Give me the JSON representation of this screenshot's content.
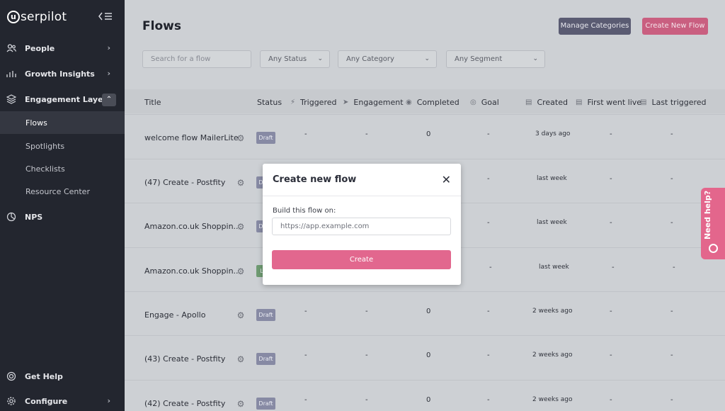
{
  "brand": {
    "logo_letter": "u",
    "logo_rest": "serpilot"
  },
  "sidebar": {
    "items": [
      {
        "label": "People"
      },
      {
        "label": "Growth Insights"
      },
      {
        "label": "Engagement Layer"
      },
      {
        "label": "NPS"
      },
      {
        "label": "Get Help"
      },
      {
        "label": "Configure"
      }
    ],
    "sub_items": [
      {
        "label": "Flows"
      },
      {
        "label": "Spotlights"
      },
      {
        "label": "Checklists"
      },
      {
        "label": "Resource Center"
      }
    ]
  },
  "header": {
    "title": "Flows",
    "manage_label": "Manage Categories",
    "create_label": "Create New Flow"
  },
  "filters": {
    "search_placeholder": "Search for a flow",
    "status": "Any Status",
    "category": "Any Category",
    "segment": "Any Segment"
  },
  "table": {
    "columns": [
      "Title",
      "Status",
      "Triggered",
      "Engagement",
      "Completed",
      "Goal",
      "Created",
      "First went live",
      "Last triggered"
    ],
    "rows": [
      {
        "title": "welcome flow MailerLite",
        "status": "Draft",
        "triggered": "-",
        "engagement": "-",
        "completed": "0",
        "goal": "-",
        "created": "3 days ago",
        "first_live": "-",
        "last_triggered": "-"
      },
      {
        "title": "(47) Create - Postfity",
        "status": "Draft",
        "triggered": "",
        "engagement": "",
        "completed": "",
        "goal": "-",
        "created": "last week",
        "first_live": "-",
        "last_triggered": "-"
      },
      {
        "title": "Amazon.co.uk Shoppin...",
        "status": "Draft",
        "triggered": "",
        "engagement": "",
        "completed": "",
        "goal": "-",
        "created": "last week",
        "first_live": "-",
        "last_triggered": "-"
      },
      {
        "title": "Amazon.co.uk Shoppin...",
        "status": "Live",
        "triggered": "",
        "engagement": "",
        "completed": "",
        "goal": "-",
        "created": "last week",
        "first_live": "-",
        "last_triggered": "-"
      },
      {
        "title": "Engage - Apollo",
        "status": "Draft",
        "triggered": "-",
        "engagement": "-",
        "completed": "0",
        "goal": "-",
        "created": "2 weeks ago",
        "first_live": "-",
        "last_triggered": "-"
      },
      {
        "title": "(43) Create - Postfity",
        "status": "Draft",
        "triggered": "-",
        "engagement": "-",
        "completed": "0",
        "goal": "-",
        "created": "2 weeks ago",
        "first_live": "-",
        "last_triggered": "-"
      },
      {
        "title": "(42) Create - Postfity",
        "status": "Draft",
        "triggered": "-",
        "engagement": "-",
        "completed": "0",
        "goal": "-",
        "created": "2 weeks ago",
        "first_live": "-",
        "last_triggered": "-"
      }
    ]
  },
  "modal": {
    "title": "Create new flow",
    "field_label": "Build this flow on:",
    "url_value": "https://app.example.com",
    "create_label": "Create"
  },
  "help_tab": {
    "label": "Need help?"
  },
  "colors": {
    "sidebar_bg": "#23262f",
    "accent_pink": "#e2678e",
    "manage_button": "#5a5b72",
    "draft_badge": "#878aa4",
    "live_badge": "#6f9b72"
  }
}
